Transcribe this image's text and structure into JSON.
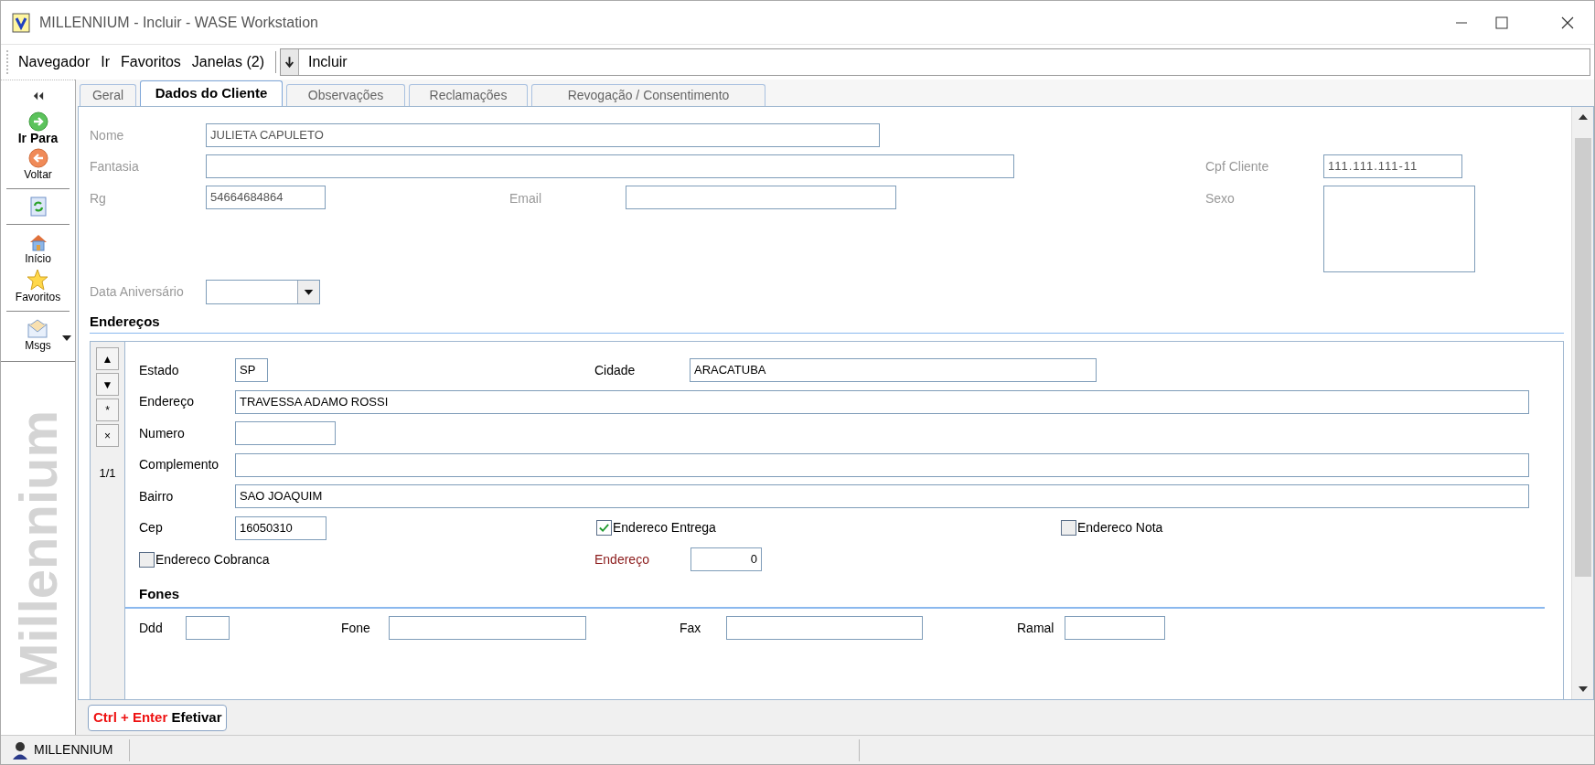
{
  "window": {
    "title": "MILLENNIUM - Incluir - WASE Workstation"
  },
  "menu": [
    "Navegador",
    "Ir",
    "Favoritos",
    "Janelas (2)"
  ],
  "address_bar": {
    "value": "Incluir"
  },
  "sidebar": {
    "items": [
      {
        "kind": "goto",
        "label": "Ir Para",
        "emphasized": true
      },
      {
        "kind": "back",
        "label": "Voltar",
        "emphasized": false
      },
      {
        "kind": "separator"
      },
      {
        "kind": "refresh"
      },
      {
        "kind": "separator"
      },
      {
        "kind": "home",
        "label": "Início",
        "emphasized": false
      },
      {
        "kind": "star",
        "label": "Favoritos",
        "emphasized": false
      },
      {
        "kind": "separator"
      },
      {
        "kind": "mail",
        "label": "Msgs",
        "emphasized": false
      }
    ],
    "watermark": "Millennium"
  },
  "tabs": [
    {
      "label": "Geral",
      "selected": false
    },
    {
      "label": "Dados do Cliente",
      "selected": true
    },
    {
      "label": "Observações",
      "selected": false
    },
    {
      "label": "Reclamações",
      "selected": false
    },
    {
      "label": "Revogação / Consentimento",
      "selected": false
    }
  ],
  "client": {
    "name": {
      "label": "Nome",
      "value": "JULIETA CAPULETO"
    },
    "trade_name": {
      "label": "Fantasia"
    },
    "cpf": {
      "label": "Cpf Cliente",
      "value": "111.111.111-11"
    },
    "rg": {
      "label": "Rg",
      "value": "54664684864"
    },
    "email": {
      "label": "Email"
    },
    "sex": {
      "label": "Sexo"
    },
    "birthday": {
      "label": "Data Aniversário"
    }
  },
  "addresses": {
    "heading": "Endereços",
    "nav": [
      "▲",
      "▼",
      "*",
      "×"
    ],
    "counter": "1/1",
    "state": {
      "label": "Estado",
      "value": "SP"
    },
    "city": {
      "label": "Cidade",
      "value": "ARACATUBA"
    },
    "street": {
      "label": "Endereço",
      "value": "TRAVESSA ADAMO ROSSI"
    },
    "number": {
      "label": "Numero"
    },
    "complement": {
      "label": "Complemento"
    },
    "district": {
      "label": "Bairro",
      "value": "SAO JOAQUIM"
    },
    "zip": {
      "label": "Cep",
      "value": "16050310"
    },
    "delivery": {
      "label": "Endereco Entrega",
      "checked": true
    },
    "invoice": {
      "label": "Endereco Nota",
      "checked": false
    },
    "billing": {
      "label": "Endereco Cobranca",
      "checked": false
    },
    "address_no": {
      "label": "Endereço",
      "value": "0"
    },
    "phones": {
      "heading": "Fones",
      "ddd": {
        "label": "Ddd"
      },
      "phone": {
        "label": "Fone"
      },
      "fax": {
        "label": "Fax"
      },
      "extension": {
        "label": "Ramal"
      }
    }
  },
  "action_button": {
    "shortcut": "Ctrl + Enter",
    "label": "Efetivar"
  },
  "status_bar": {
    "text": "MILLENNIUM"
  }
}
